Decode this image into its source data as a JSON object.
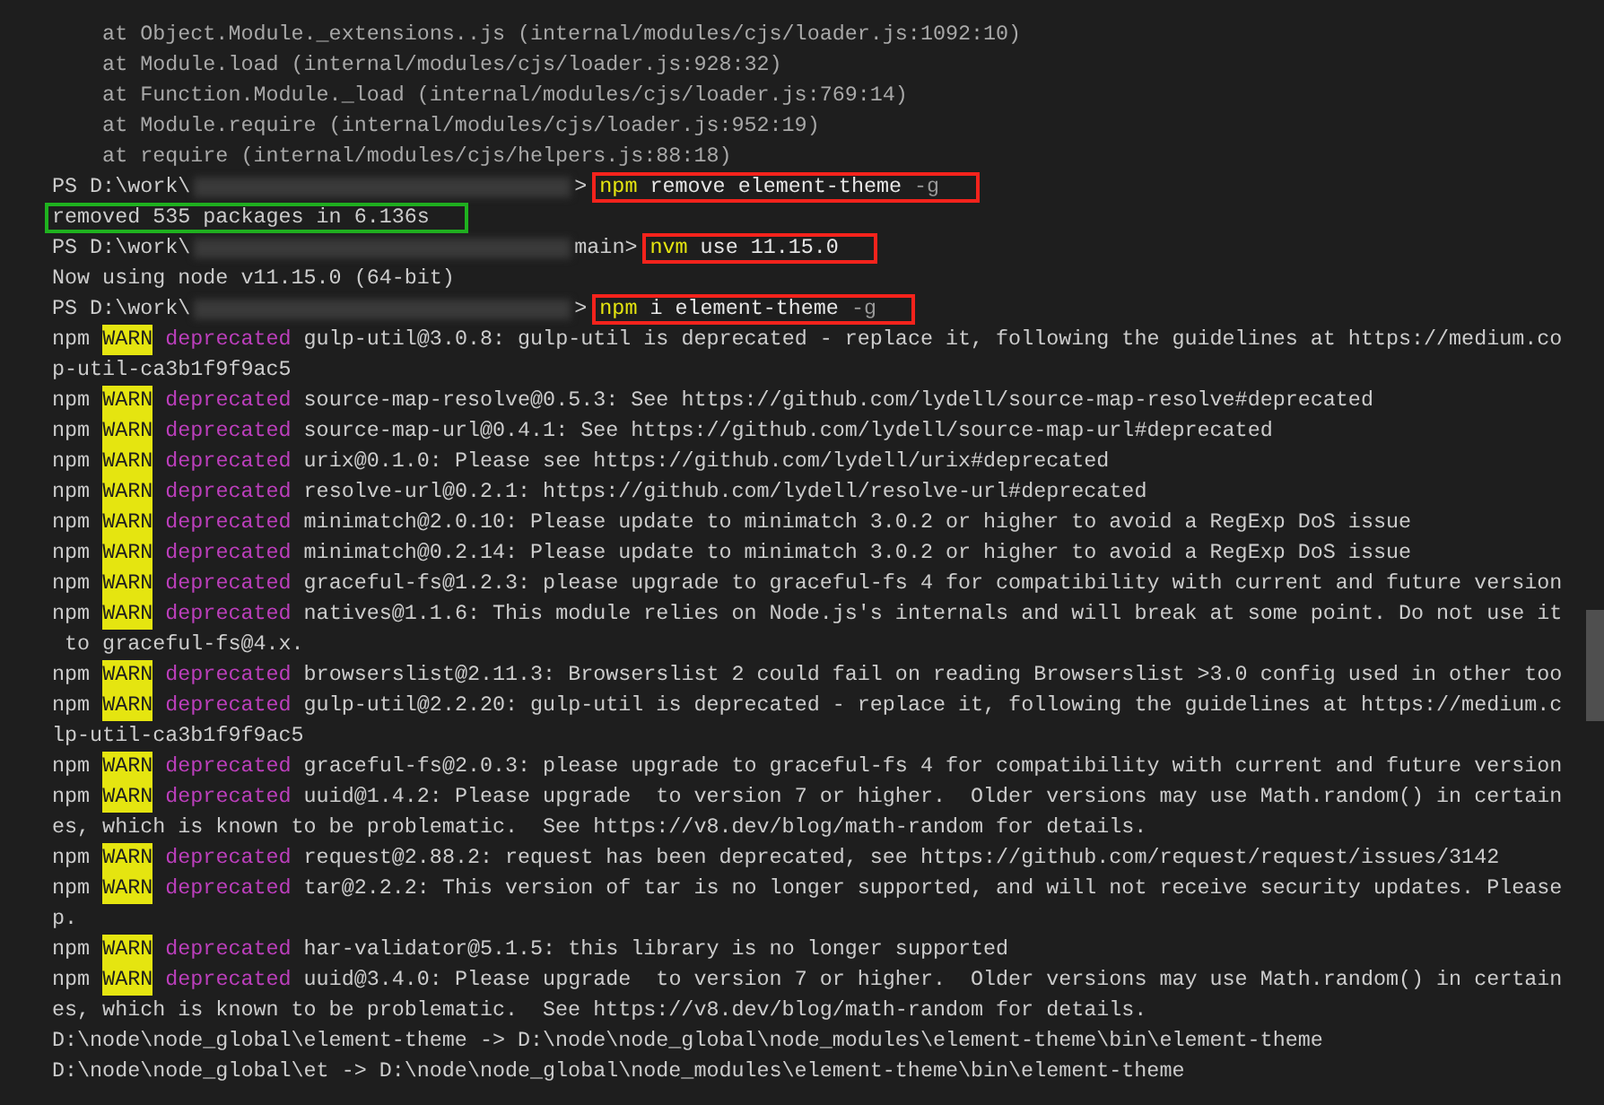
{
  "terminal": {
    "lines": [
      {
        "kind": "trace",
        "text": "    at Object.Module._extensions..js (internal/modules/cjs/loader.js:1092:10)"
      },
      {
        "kind": "trace",
        "text": "    at Module.load (internal/modules/cjs/loader.js:928:32)"
      },
      {
        "kind": "trace",
        "text": "    at Function.Module._load (internal/modules/cjs/loader.js:769:14)"
      },
      {
        "kind": "trace",
        "text": "    at Module.require (internal/modules/cjs/loader.js:952:19)"
      },
      {
        "kind": "trace",
        "text": "    at require (internal/modules/cjs/helpers.js:88:18)"
      },
      {
        "kind": "prompt",
        "prompt": "PS D:\\work\\",
        "prompt_end": ">",
        "program": "npm",
        "args": " remove element-theme",
        "flag": " -g",
        "color": "#f5231c"
      },
      {
        "kind": "output",
        "text": "removed 535 packages in 6.136s",
        "color": "#1fb21f"
      },
      {
        "kind": "prompt",
        "prompt": "PS D:\\work\\",
        "prompt_end": "main>",
        "program": "nvm",
        "args": " use 11.15.0",
        "color": "#f5231c"
      },
      {
        "kind": "output",
        "text": "Now using node v11.15.0 (64-bit)"
      },
      {
        "kind": "prompt",
        "prompt": "PS D:\\work\\",
        "prompt_end": ">",
        "program": "npm",
        "args": " i element-theme",
        "flag": " -g",
        "color": "#f5231c"
      },
      {
        "kind": "warn",
        "npm": "npm",
        "level": "WARN",
        "tag": "deprecated",
        "text": " gulp-util@3.0.8: gulp-util is deprecated - replace it, following the guidelines at https://medium.co"
      },
      {
        "kind": "output",
        "text": "p-util-ca3b1f9f9ac5"
      },
      {
        "kind": "warn",
        "npm": "npm",
        "level": "WARN",
        "tag": "deprecated",
        "text": " source-map-resolve@0.5.3: See https://github.com/lydell/source-map-resolve#deprecated"
      },
      {
        "kind": "warn",
        "npm": "npm",
        "level": "WARN",
        "tag": "deprecated",
        "text": " source-map-url@0.4.1: See https://github.com/lydell/source-map-url#deprecated"
      },
      {
        "kind": "warn",
        "npm": "npm",
        "level": "WARN",
        "tag": "deprecated",
        "text": " urix@0.1.0: Please see https://github.com/lydell/urix#deprecated"
      },
      {
        "kind": "warn",
        "npm": "npm",
        "level": "WARN",
        "tag": "deprecated",
        "text": " resolve-url@0.2.1: https://github.com/lydell/resolve-url#deprecated"
      },
      {
        "kind": "warn",
        "npm": "npm",
        "level": "WARN",
        "tag": "deprecated",
        "text": " minimatch@2.0.10: Please update to minimatch 3.0.2 or higher to avoid a RegExp DoS issue"
      },
      {
        "kind": "warn",
        "npm": "npm",
        "level": "WARN",
        "tag": "deprecated",
        "text": " minimatch@0.2.14: Please update to minimatch 3.0.2 or higher to avoid a RegExp DoS issue"
      },
      {
        "kind": "warn",
        "npm": "npm",
        "level": "WARN",
        "tag": "deprecated",
        "text": " graceful-fs@1.2.3: please upgrade to graceful-fs 4 for compatibility with current and future version"
      },
      {
        "kind": "warn",
        "npm": "npm",
        "level": "WARN",
        "tag": "deprecated",
        "text": " natives@1.1.6: This module relies on Node.js's internals and will break at some point. Do not use it"
      },
      {
        "kind": "output",
        "text": " to graceful-fs@4.x."
      },
      {
        "kind": "warn",
        "npm": "npm",
        "level": "WARN",
        "tag": "deprecated",
        "text": " browserslist@2.11.3: Browserslist 2 could fail on reading Browserslist >3.0 config used in other too"
      },
      {
        "kind": "warn",
        "npm": "npm",
        "level": "WARN",
        "tag": "deprecated",
        "text": " gulp-util@2.2.20: gulp-util is deprecated - replace it, following the guidelines at https://medium.c"
      },
      {
        "kind": "output",
        "text": "lp-util-ca3b1f9f9ac5"
      },
      {
        "kind": "warn",
        "npm": "npm",
        "level": "WARN",
        "tag": "deprecated",
        "text": " graceful-fs@2.0.3: please upgrade to graceful-fs 4 for compatibility with current and future version"
      },
      {
        "kind": "warn",
        "npm": "npm",
        "level": "WARN",
        "tag": "deprecated",
        "text": " uuid@1.4.2: Please upgrade  to version 7 or higher.  Older versions may use Math.random() in certain"
      },
      {
        "kind": "output",
        "text": "es, which is known to be problematic.  See https://v8.dev/blog/math-random for details."
      },
      {
        "kind": "warn",
        "npm": "npm",
        "level": "WARN",
        "tag": "deprecated",
        "text": " request@2.88.2: request has been deprecated, see https://github.com/request/request/issues/3142"
      },
      {
        "kind": "warn",
        "npm": "npm",
        "level": "WARN",
        "tag": "deprecated",
        "text": " tar@2.2.2: This version of tar is no longer supported, and will not receive security updates. Please"
      },
      {
        "kind": "output",
        "text": "p."
      },
      {
        "kind": "warn",
        "npm": "npm",
        "level": "WARN",
        "tag": "deprecated",
        "text": " har-validator@5.1.5: this library is no longer supported"
      },
      {
        "kind": "warn",
        "npm": "npm",
        "level": "WARN",
        "tag": "deprecated",
        "text": " uuid@3.4.0: Please upgrade  to version 7 or higher.  Older versions may use Math.random() in certain"
      },
      {
        "kind": "output",
        "text": "es, which is known to be problematic.  See https://v8.dev/blog/math-random for details."
      },
      {
        "kind": "output",
        "text": "D:\\node\\node_global\\element-theme -> D:\\node\\node_global\\node_modules\\element-theme\\bin\\element-theme"
      },
      {
        "kind": "output",
        "text": "D:\\node\\node_global\\et -> D:\\node\\node_global\\node_modules\\element-theme\\bin\\element-theme"
      }
    ]
  }
}
